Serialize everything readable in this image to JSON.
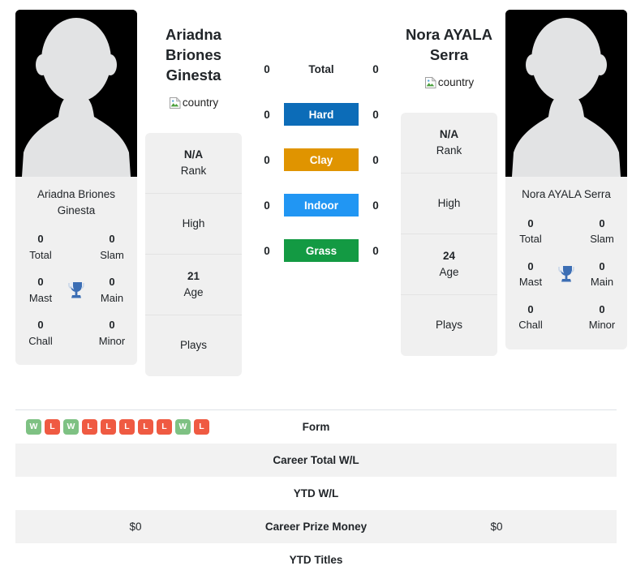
{
  "players": {
    "left": {
      "name": "Ariadna Briones Ginesta",
      "card_name": "Ariadna Briones Ginesta",
      "country_alt": "country",
      "avatar_alt": "player-photo",
      "titles": {
        "total_value": "0",
        "total_label": "Total",
        "slam_value": "0",
        "slam_label": "Slam",
        "mast_value": "0",
        "mast_label": "Mast",
        "main_value": "0",
        "main_label": "Main",
        "chall_value": "0",
        "chall_label": "Chall",
        "minor_value": "0",
        "minor_label": "Minor"
      },
      "info": [
        {
          "value": "N/A",
          "label": "Rank"
        },
        {
          "value": "",
          "label": "High"
        },
        {
          "value": "21",
          "label": "Age"
        },
        {
          "value": "",
          "label": "Plays"
        }
      ],
      "surface_wins": {
        "total": "0",
        "hard": "0",
        "clay": "0",
        "indoor": "0",
        "grass": "0"
      },
      "form": [
        "W",
        "L",
        "W",
        "L",
        "L",
        "L",
        "L",
        "L",
        "W",
        "L"
      ],
      "career_total_wl": "",
      "ytd_wl": "",
      "career_prize_money": "$0",
      "ytd_titles": ""
    },
    "right": {
      "name": "Nora AYALA Serra",
      "card_name": "Nora AYALA Serra",
      "country_alt": "country",
      "avatar_alt": "player-photo",
      "titles": {
        "total_value": "0",
        "total_label": "Total",
        "slam_value": "0",
        "slam_label": "Slam",
        "mast_value": "0",
        "mast_label": "Mast",
        "main_value": "0",
        "main_label": "Main",
        "chall_value": "0",
        "chall_label": "Chall",
        "minor_value": "0",
        "minor_label": "Minor"
      },
      "info": [
        {
          "value": "N/A",
          "label": "Rank"
        },
        {
          "value": "",
          "label": "High"
        },
        {
          "value": "24",
          "label": "Age"
        },
        {
          "value": "",
          "label": "Plays"
        }
      ],
      "surface_wins": {
        "total": "0",
        "hard": "0",
        "clay": "0",
        "indoor": "0",
        "grass": "0"
      },
      "form": [],
      "career_total_wl": "",
      "ytd_wl": "",
      "career_prize_money": "$0",
      "ytd_titles": ""
    }
  },
  "surfaces": [
    {
      "label": "Total",
      "color": "transparent",
      "plain": true
    },
    {
      "label": "Hard",
      "color": "#0c6cb8"
    },
    {
      "label": "Clay",
      "color": "#e09400"
    },
    {
      "label": "Indoor",
      "color": "#2196f3"
    },
    {
      "label": "Grass",
      "color": "#139a43"
    }
  ],
  "table_rows": [
    {
      "label": "Form"
    },
    {
      "label": "Career Total W/L"
    },
    {
      "label": "YTD W/L"
    },
    {
      "label": "Career Prize Money"
    },
    {
      "label": "YTD Titles"
    }
  ],
  "colors": {
    "hard": "#0c6cb8",
    "clay": "#e09400",
    "indoor": "#2196f3",
    "grass": "#139a43",
    "win_badge": "#7ec183",
    "loss_badge": "#ef5a42",
    "card_bg": "#f0f0f0",
    "row_stripe": "#f2f2f2",
    "trophy": "#3c6eb4"
  }
}
